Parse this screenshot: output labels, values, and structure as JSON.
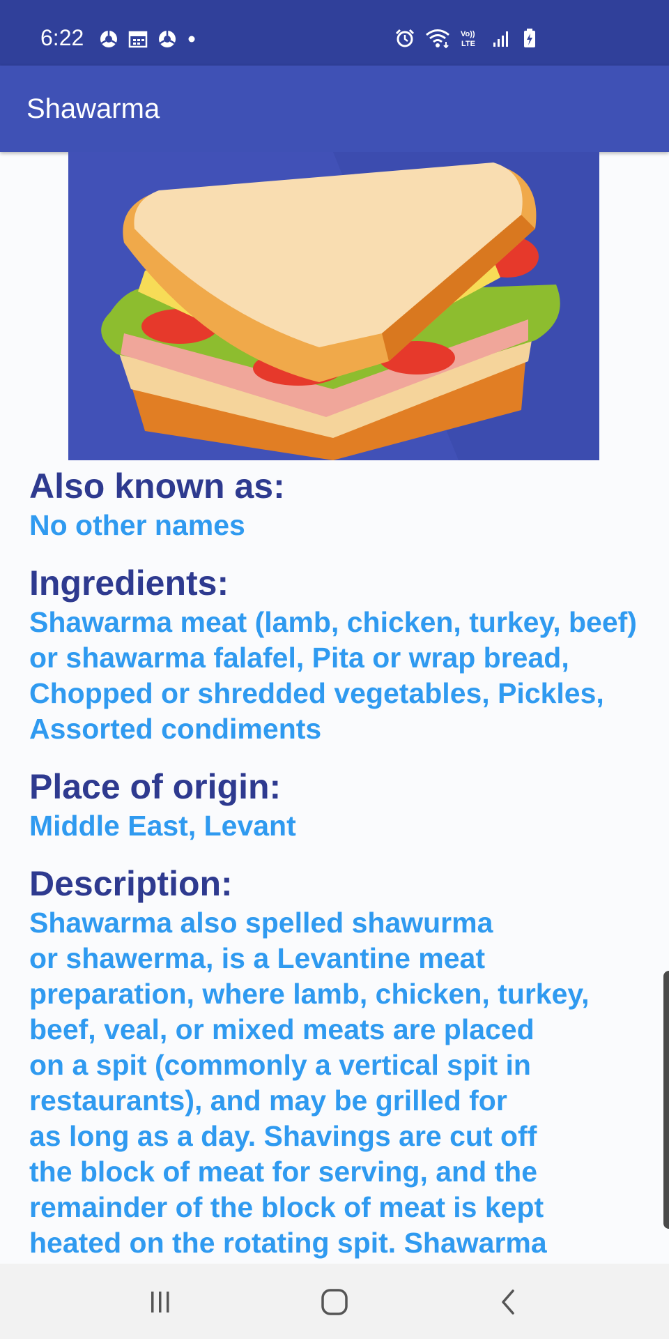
{
  "status_bar": {
    "time": "6:22",
    "left_icons": [
      "chrome-icon",
      "calendar-icon",
      "chrome-icon",
      "notification-dot-icon"
    ],
    "right_icons": [
      "alarm-icon",
      "wifi-icon",
      "volte-icon",
      "signal-icon",
      "battery-charging-icon"
    ],
    "volte_label_top": "Vo))",
    "volte_label_bottom": "LTE"
  },
  "app_bar": {
    "title": "Shawarma"
  },
  "hero_image": {
    "icon": "sandwich-icon",
    "background_color": "#4151b7"
  },
  "sections": [
    {
      "label": "Also known as:",
      "value": "No other names"
    },
    {
      "label": "Ingredients:",
      "value": "Shawarma meat (lamb, chicken, turkey, beef) or shawarma falafel, Pita or wrap bread, Chopped or shredded vegetables, Pickles, Assorted condiments"
    },
    {
      "label": "Place of origin:",
      "value": "Middle East, Levant"
    },
    {
      "label": "Description:",
      "value": "Shawarma also spelled shawurma\nor shawerma, is a Levantine meat\npreparation, where lamb, chicken, turkey,\nbeef, veal, or mixed meats are placed\non a spit (commonly a vertical spit in\nrestaurants), and may be grilled for\nas long as a day. Shavings are cut off\nthe block of meat for serving, and the\nremainder of the block of meat is kept\nheated on the rotating spit. Shawarma"
    }
  ],
  "nav_bar": {
    "icons": [
      "recent-apps-icon",
      "home-icon",
      "back-icon"
    ]
  },
  "colors": {
    "status_bar": "#30409a",
    "app_bar": "#3f51b5",
    "label": "#2e3a8f",
    "value": "#2f9af0",
    "background": "#fafbfd"
  }
}
